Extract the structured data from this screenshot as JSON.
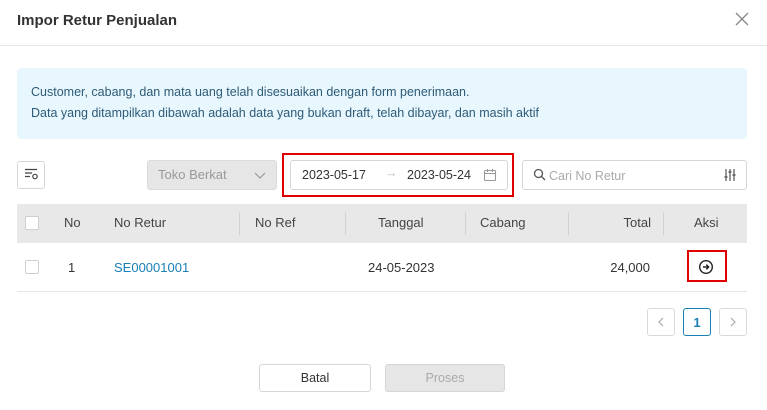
{
  "modal": {
    "title": "Impor Retur Penjualan"
  },
  "alert": {
    "line1": "Customer, cabang, dan mata uang telah disesuaikan dengan form penerimaan.",
    "line2": "Data yang ditampilkan dibawah adalah data yang bukan draft, telah dibayar, dan masih aktif"
  },
  "filters": {
    "branch_placeholder": "Toko Berkat",
    "date_start": "2023-05-17",
    "date_arrow": "→",
    "date_end": "2023-05-24",
    "search_placeholder": "Cari No Retur"
  },
  "table": {
    "headers": {
      "no": "No",
      "no_retur": "No Retur",
      "no_ref": "No Ref",
      "tanggal": "Tanggal",
      "cabang": "Cabang",
      "total": "Total",
      "aksi": "Aksi"
    },
    "rows": [
      {
        "no": "1",
        "no_retur": "SE00001001",
        "no_ref": "",
        "tanggal": "24-05-2023",
        "cabang": "",
        "total": "24,000"
      }
    ]
  },
  "pagination": {
    "current_page": "1"
  },
  "footer": {
    "cancel_label": "Batal",
    "process_label": "Proses"
  },
  "colors": {
    "accent": "#1a7fb5",
    "alert_bg": "#e8f6fd",
    "highlight": "#e00000"
  },
  "icons": {
    "close": "close-icon",
    "columns": "column-settings-icon",
    "chevron": "chevron-down-icon",
    "calendar": "calendar-icon",
    "search": "search-icon",
    "filter": "sliders-icon",
    "action": "arrow-circle-right-icon",
    "prev": "chevron-left-icon",
    "next": "chevron-right-icon"
  }
}
